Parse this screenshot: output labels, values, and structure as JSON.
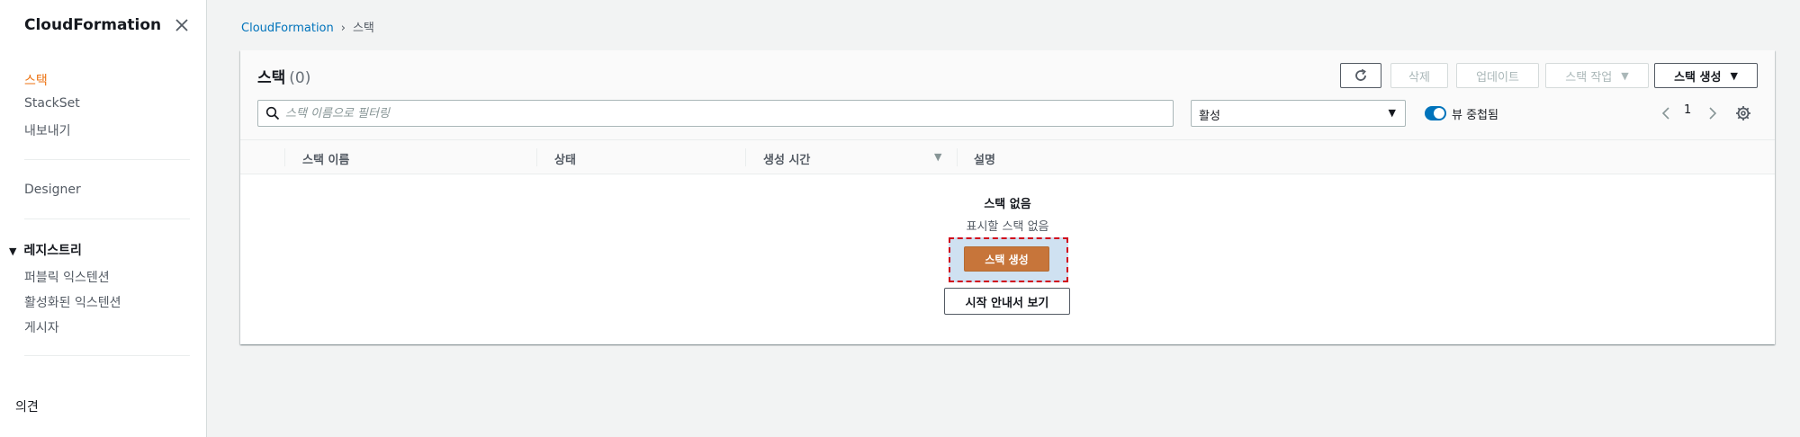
{
  "sidebar": {
    "title": "CloudFormation",
    "links": [
      "스택",
      "StackSet",
      "내보내기"
    ],
    "designer": "Designer",
    "registry": {
      "label": "레지스트리",
      "items": [
        "퍼블릭 익스텐션",
        "활성화된 익스텐션",
        "게시자"
      ]
    },
    "feedback": "의견"
  },
  "breadcrumb": {
    "root": "CloudFormation",
    "current": "스택"
  },
  "panel": {
    "title": "스택",
    "count": "(0)",
    "buttons": {
      "delete": "삭제",
      "update": "업데이트",
      "actions": "스택 작업",
      "create": "스택 생성"
    },
    "search_placeholder": "스택 이름으로 필터링",
    "filter_value": "활성",
    "toggle_label": "뷰 중첩됨",
    "page": "1"
  },
  "table": {
    "columns": [
      "스택 이름",
      "상태",
      "생성 시간",
      "설명"
    ]
  },
  "empty": {
    "title": "스택 없음",
    "subtitle": "표시할 스택 없음",
    "create_button": "스택 생성",
    "guide_button": "시작 안내서 보기"
  },
  "colors": {
    "accent": "#ec7211",
    "link": "#0073bb",
    "primary_button": "#c7753a",
    "highlight": "#cfe1f1"
  }
}
